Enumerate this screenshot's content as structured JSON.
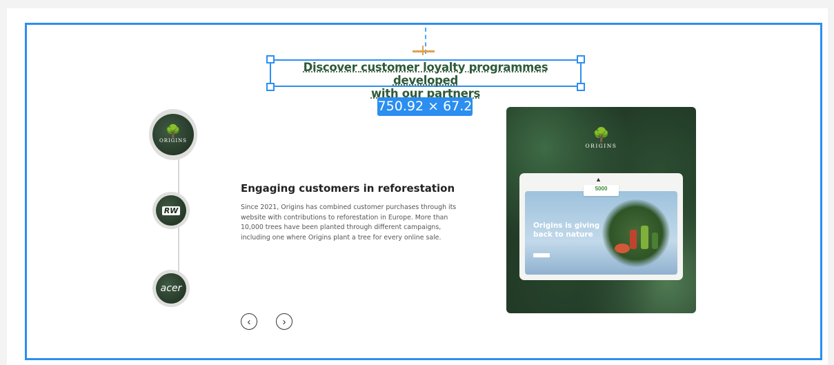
{
  "headline": {
    "part1": "Discover ",
    "bold": "customer loyalty",
    "part2": " programmes developed",
    "line2": "with our partners"
  },
  "dimension_badge": "750.92 × 67.2",
  "timeline": {
    "logos": [
      "ORIGINS",
      "RW",
      "acer"
    ]
  },
  "story": {
    "heading": "Engaging customers in reforestation",
    "paragraph": "Since 2021, Origins has combined customer purchases through its website with contributions to reforestation in Europe. More than 10,000 trees have been planted through different campaigns, including one where Origins plant a tree for every online sale."
  },
  "nav": {
    "prev_icon": "‹",
    "next_icon": "›"
  },
  "promo": {
    "brand": "ORIGINS",
    "counter": "5000",
    "hero_title": "Origins is giving back to nature"
  },
  "colors": {
    "selection": "#2b8ef0",
    "headline": "#2f5a3a",
    "counter": "#3a8a3a"
  }
}
